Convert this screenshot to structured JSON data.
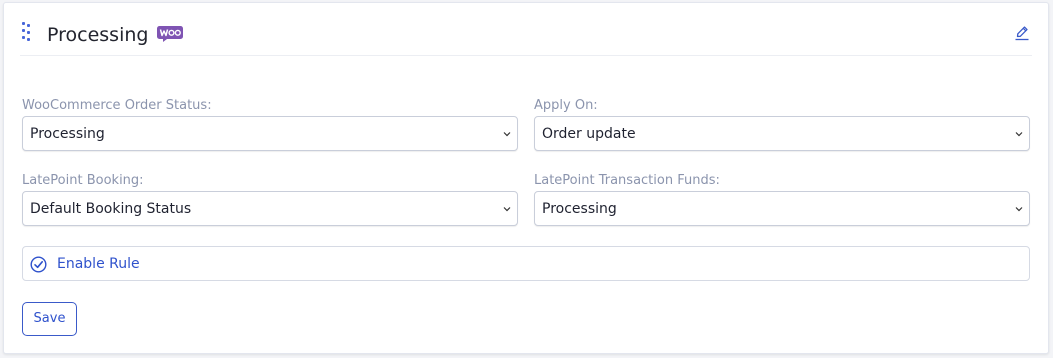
{
  "header": {
    "title": "Processing",
    "badge_text": "Woo",
    "badge_color": "#7f54b3"
  },
  "icons": {
    "drag": "drag-handle-icon",
    "badge": "woocommerce-logo",
    "edit": "pencil-icon",
    "check": "check-circle-icon"
  },
  "fields": {
    "order_status": {
      "label": "WooCommerce Order Status:",
      "value": "Processing"
    },
    "apply_on": {
      "label": "Apply On:",
      "value": "Order update"
    },
    "booking": {
      "label": "LatePoint Booking:",
      "value": "Default Booking Status"
    },
    "transaction_funds": {
      "label": "LatePoint Transaction Funds:",
      "value": "Processing"
    }
  },
  "rule": {
    "label": "Enable Rule",
    "enabled": true
  },
  "actions": {
    "save_label": "Save"
  },
  "colors": {
    "accent": "#2f52cc",
    "label": "#8b94ad",
    "text": "#1f2230"
  }
}
